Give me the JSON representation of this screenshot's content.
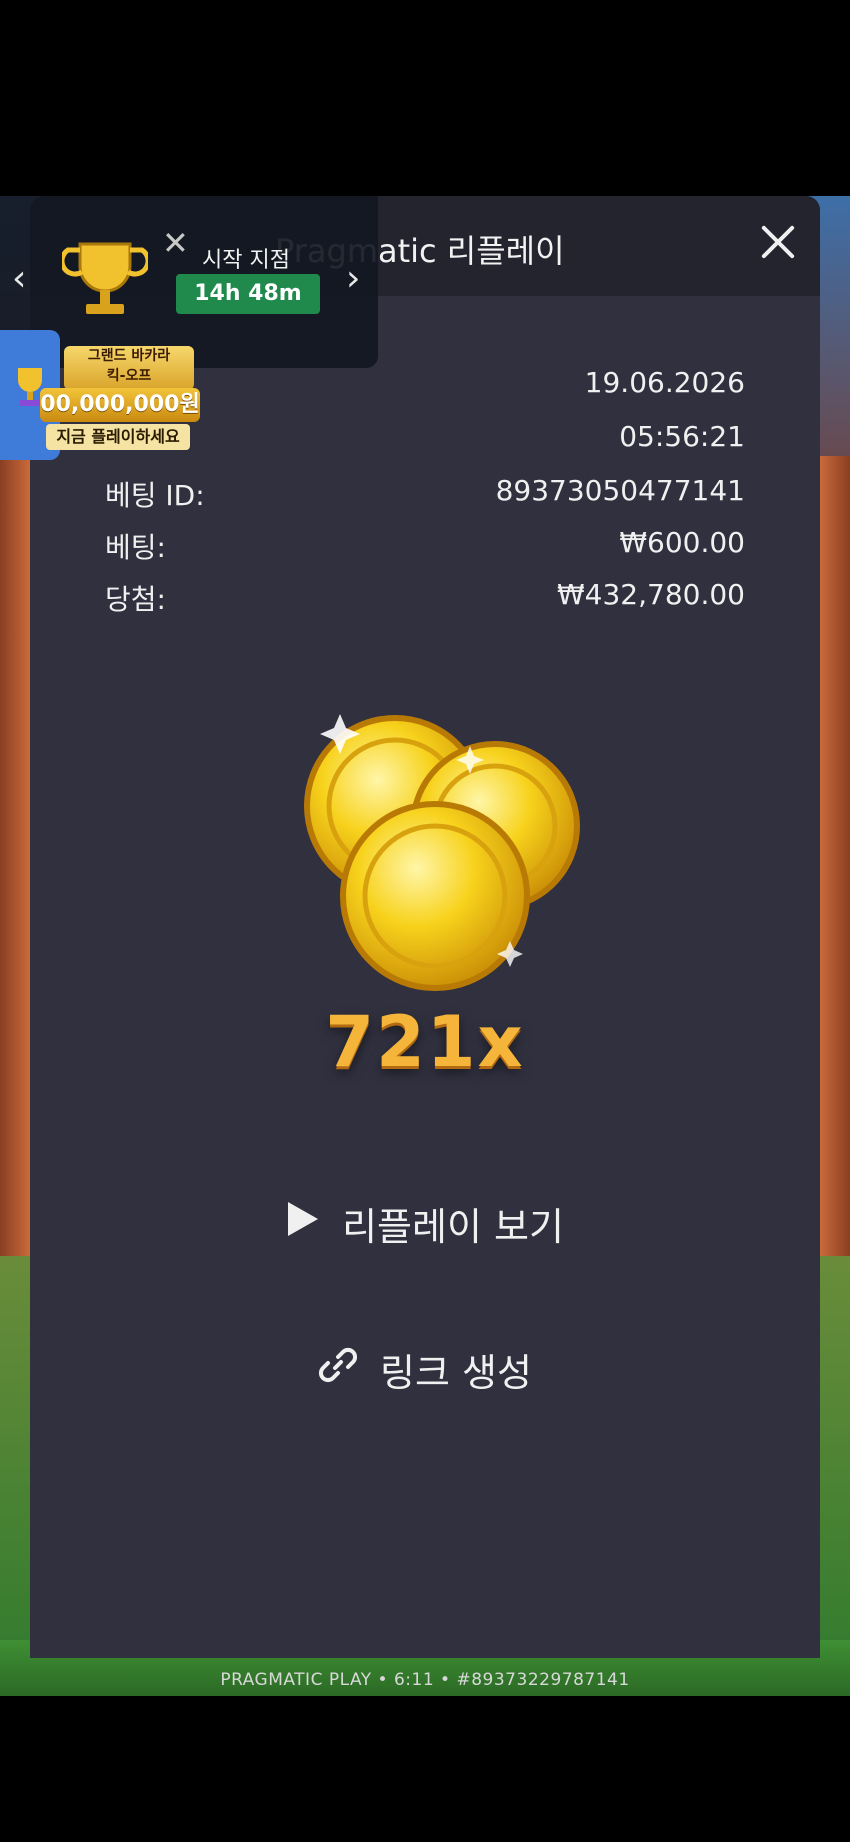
{
  "modal": {
    "title": "Pragmatic 리플레이",
    "date": "19.06.2026",
    "time": "05:56:21",
    "bet_id_label": "베팅 ID:",
    "bet_id": "89373050477141",
    "bet_label": "베팅:",
    "bet": "₩600.00",
    "win_label": "당첨:",
    "win": "₩432,780.00",
    "multiplier": "721x",
    "watch_replay": "리플레이 보기",
    "create_link": "링크 생성"
  },
  "tournament": {
    "start_label": "시작 지점",
    "timer": "14h 48m"
  },
  "promo": {
    "title_line1": "그랜드 바카라",
    "title_line2": "킥-오프",
    "amount": "00,000,000원",
    "cta": "지금 플레이하세요"
  },
  "footer": {
    "text": "PRAGMATIC PLAY • 6:11 • #89373229787141"
  },
  "colors": {
    "modal_bg": "#30303f",
    "header_bg": "#24242f",
    "multiplier": "#f5b53a",
    "timer_bg": "#1f8a4c"
  }
}
